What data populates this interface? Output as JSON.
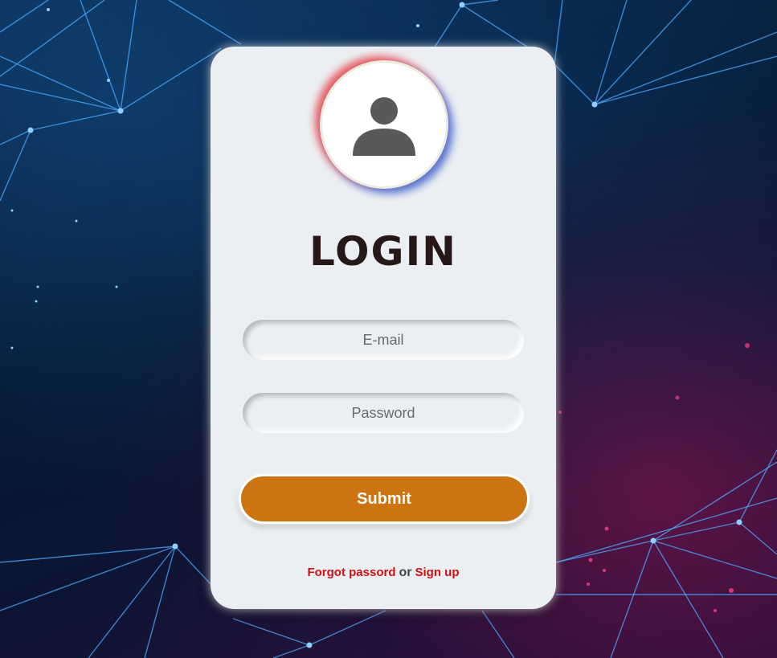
{
  "background": {
    "colors": {
      "line": "#4aa8ff",
      "node": "#8fd0ff",
      "accent_pink": "#ff3c8c"
    }
  },
  "login_card": {
    "avatar_icon": "user-icon",
    "title": "LOGIN",
    "email_placeholder": "E-mail",
    "email_value": "",
    "password_placeholder": "Password",
    "password_value": "",
    "submit_label": "Submit",
    "forgot_password_label": "Forgot passord",
    "or_text": "or",
    "sign_up_label": "Sign up",
    "colors": {
      "card": "#eceff2",
      "submit": "#cc7412",
      "link": "#d10f0f",
      "title": "#261818"
    }
  }
}
